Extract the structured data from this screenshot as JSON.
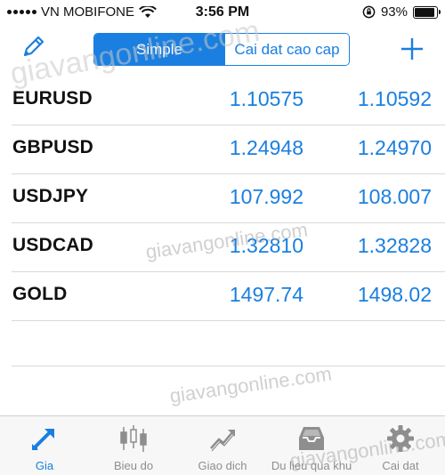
{
  "status_bar": {
    "carrier": "VN MOBIFONE",
    "time": "3:56 PM",
    "battery": "93%",
    "battery_level": 0.93
  },
  "nav": {
    "segments": [
      "Simple",
      "Cai dat cao cap"
    ],
    "selected_segment": "Simple",
    "edit_icon": "pencil-icon",
    "add_icon": "plus-icon"
  },
  "quotes": [
    {
      "symbol": "EURUSD",
      "bid": "1.10575",
      "ask": "1.10592"
    },
    {
      "symbol": "GBPUSD",
      "bid": "1.24948",
      "ask": "1.24970"
    },
    {
      "symbol": "USDJPY",
      "bid": "107.992",
      "ask": "108.007"
    },
    {
      "symbol": "USDCAD",
      "bid": "1.32810",
      "ask": "1.32828"
    },
    {
      "symbol": "GOLD",
      "bid": "1497.74",
      "ask": "1498.02"
    }
  ],
  "watermarks": [
    "giavangonline.com",
    "giavangonline.com",
    "giavangonline.com",
    "giavangonline.com"
  ],
  "tabs": [
    {
      "label": "Gia",
      "icon": "arrows-icon",
      "active": true
    },
    {
      "label": "Bieu do",
      "icon": "candlestick-icon",
      "active": false
    },
    {
      "label": "Giao dich",
      "icon": "trend-icon",
      "active": false
    },
    {
      "label": "Du lieu qua khu",
      "icon": "inbox-icon",
      "active": false
    },
    {
      "label": "Cai dat",
      "icon": "gear-icon",
      "active": false
    }
  ],
  "colors": {
    "accent": "#1a7fe0",
    "text": "#111111",
    "inactive_tab": "#8e8e8e"
  }
}
